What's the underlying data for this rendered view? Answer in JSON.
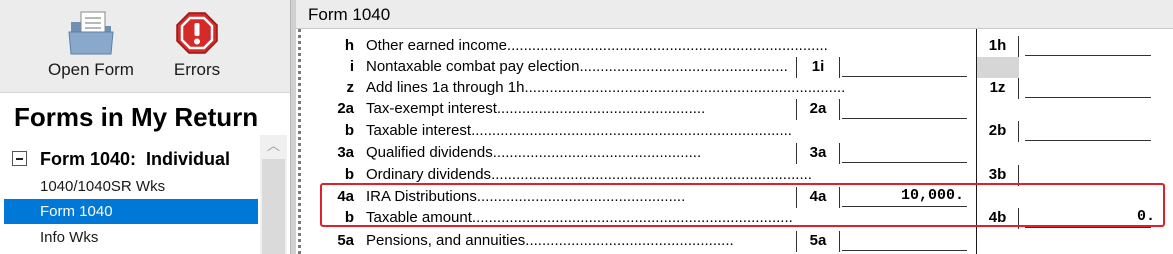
{
  "toolbar": {
    "open_form_label": "Open Form",
    "errors_label": "Errors",
    "open_form_icon": "folder-document-icon",
    "errors_icon": "error-exclamation-icon"
  },
  "sidebar": {
    "title": "Forms in My Return",
    "group_label": "Form 1040:  Individual",
    "items": [
      {
        "label": "1040/1040SR Wks",
        "selected": false
      },
      {
        "label": "Form 1040",
        "selected": true
      },
      {
        "label": "Info Wks",
        "selected": false
      }
    ]
  },
  "tab": {
    "title": "Form 1040"
  },
  "rows": [
    {
      "num": "h",
      "desc": "Other earned income",
      "line": "1h"
    },
    {
      "num": "i",
      "desc": "Nontaxable combat pay election",
      "code": "1i",
      "value": ""
    },
    {
      "num": "z",
      "desc": "Add lines 1a through 1h",
      "line": "1z"
    },
    {
      "num": "2a",
      "desc": "Tax-exempt interest",
      "code": "2a",
      "value": ""
    },
    {
      "num": "b",
      "desc": "Taxable interest",
      "line": "2b"
    },
    {
      "num": "3a",
      "desc": "Qualified dividends",
      "code": "3a",
      "value": ""
    },
    {
      "num": "b",
      "desc": "Ordinary dividends",
      "line": "3b"
    },
    {
      "num": "4a",
      "desc": "IRA Distributions",
      "code": "4a",
      "value": "10,000."
    },
    {
      "num": "b",
      "desc": "Taxable amount",
      "line": "4b",
      "line_value": "0."
    },
    {
      "num": "5a",
      "desc": "Pensions, and annuities",
      "code": "5a",
      "value": ""
    }
  ],
  "colors": {
    "selected": "#0078d7",
    "highlight": "#e0202a",
    "error_red": "#d42a2a"
  }
}
